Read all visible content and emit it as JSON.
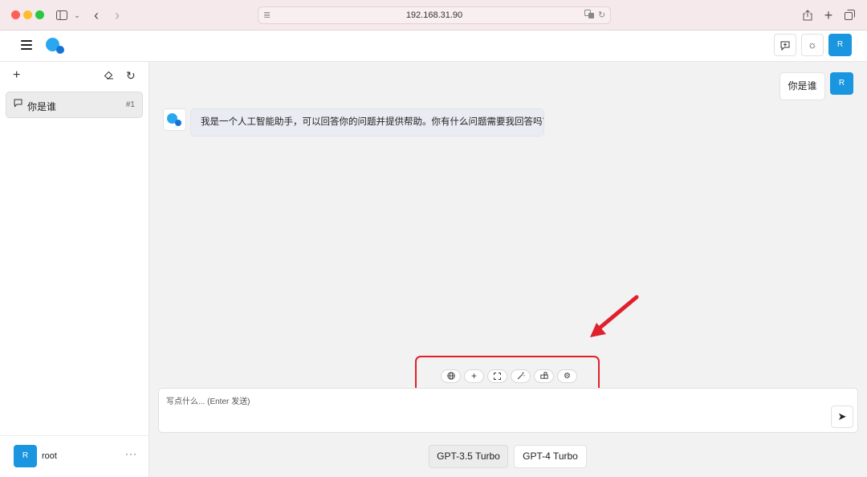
{
  "browser": {
    "url": "192.168.31.90",
    "icons": [
      "sidebar-toggle-icon",
      "chevron-down-icon",
      "back-icon",
      "forward-icon",
      "reader-icon",
      "translate-icon",
      "reload-icon",
      "share-icon",
      "new-tab-icon",
      "tabs-overview-icon"
    ]
  },
  "header": {
    "user_initial": "R",
    "icons": [
      "menu-icon",
      "app-logo",
      "chat-settings-icon",
      "theme-sun-icon"
    ]
  },
  "sidebar": {
    "conversations": [
      {
        "title": "你是谁",
        "index": "#1"
      }
    ],
    "user": {
      "initial": "R",
      "name": "root",
      "more": "···"
    }
  },
  "chat": {
    "messages": [
      {
        "role": "user",
        "text": "你是谁",
        "initial": "R"
      },
      {
        "role": "assistant",
        "text": "我是一个人工智能助手，可以回答你的问题并提供帮助。你有什么问题需要我回答吗？"
      }
    ],
    "tools": [
      "globe-icon",
      "plus-icon",
      "fullscreen-icon",
      "magic-wand-icon",
      "plugin-icon",
      "settings-icon"
    ],
    "input_placeholder": "写点什么... (Enter 发送)",
    "models": [
      {
        "label": "GPT-3.5 Turbo",
        "active": true
      },
      {
        "label": "GPT-4 Turbo",
        "active": false
      }
    ]
  }
}
